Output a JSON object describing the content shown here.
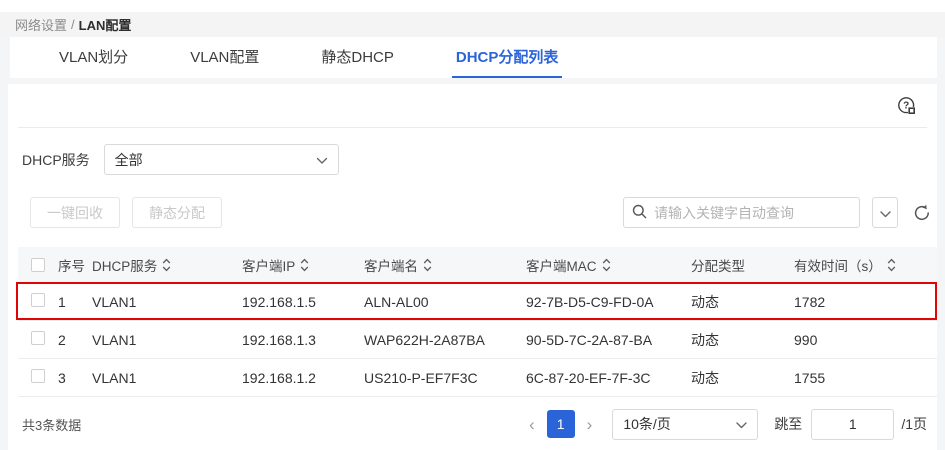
{
  "breadcrumb": {
    "section": "网络设置",
    "separator": "/",
    "current": "LAN配置"
  },
  "tabs": [
    {
      "label": "VLAN划分",
      "active": false
    },
    {
      "label": "VLAN配置",
      "active": false
    },
    {
      "label": "静态DHCP",
      "active": false
    },
    {
      "label": "DHCP分配列表",
      "active": true
    }
  ],
  "filter": {
    "label": "DHCP服务",
    "selected": "全部"
  },
  "toolbar": {
    "recycle_button": "一键回收",
    "static_assign_button": "静态分配",
    "search_placeholder": "请输入关键字自动查询"
  },
  "table": {
    "columns": [
      {
        "label": "",
        "sortable": false
      },
      {
        "label": "序号",
        "sortable": false
      },
      {
        "label": "DHCP服务",
        "sortable": true
      },
      {
        "label": "客户端IP",
        "sortable": true
      },
      {
        "label": "客户端名",
        "sortable": true
      },
      {
        "label": "客户端MAC",
        "sortable": true
      },
      {
        "label": "分配类型",
        "sortable": false
      },
      {
        "label": "有效时间（s）",
        "sortable": true
      }
    ],
    "rows": [
      {
        "index": "1",
        "dhcp_service": "VLAN1",
        "client_ip": "192.168.1.5",
        "client_name": "ALN-AL00",
        "client_mac": "92-7B-D5-C9-FD-0A",
        "alloc_type": "动态",
        "lease_time": "1782",
        "highlighted": true
      },
      {
        "index": "2",
        "dhcp_service": "VLAN1",
        "client_ip": "192.168.1.3",
        "client_name": "WAP622H-2A87BA",
        "client_mac": "90-5D-7C-2A-87-BA",
        "alloc_type": "动态",
        "lease_time": "990",
        "highlighted": false
      },
      {
        "index": "3",
        "dhcp_service": "VLAN1",
        "client_ip": "192.168.1.2",
        "client_name": "US210-P-EF7F3C",
        "client_mac": "6C-87-20-EF-7F-3C",
        "alloc_type": "动态",
        "lease_time": "1755",
        "highlighted": false
      }
    ]
  },
  "pagination": {
    "total_text": "共3条数据",
    "prev": "‹",
    "current_page": "1",
    "next": "›",
    "page_size": "10条/页",
    "jump_label": "跳至",
    "jump_value": "1",
    "total_pages_text": "/1页"
  },
  "colors": {
    "accent_blue": "#2b63d9",
    "highlight_red": "#e00505",
    "page_background": "#f4f5f6"
  }
}
